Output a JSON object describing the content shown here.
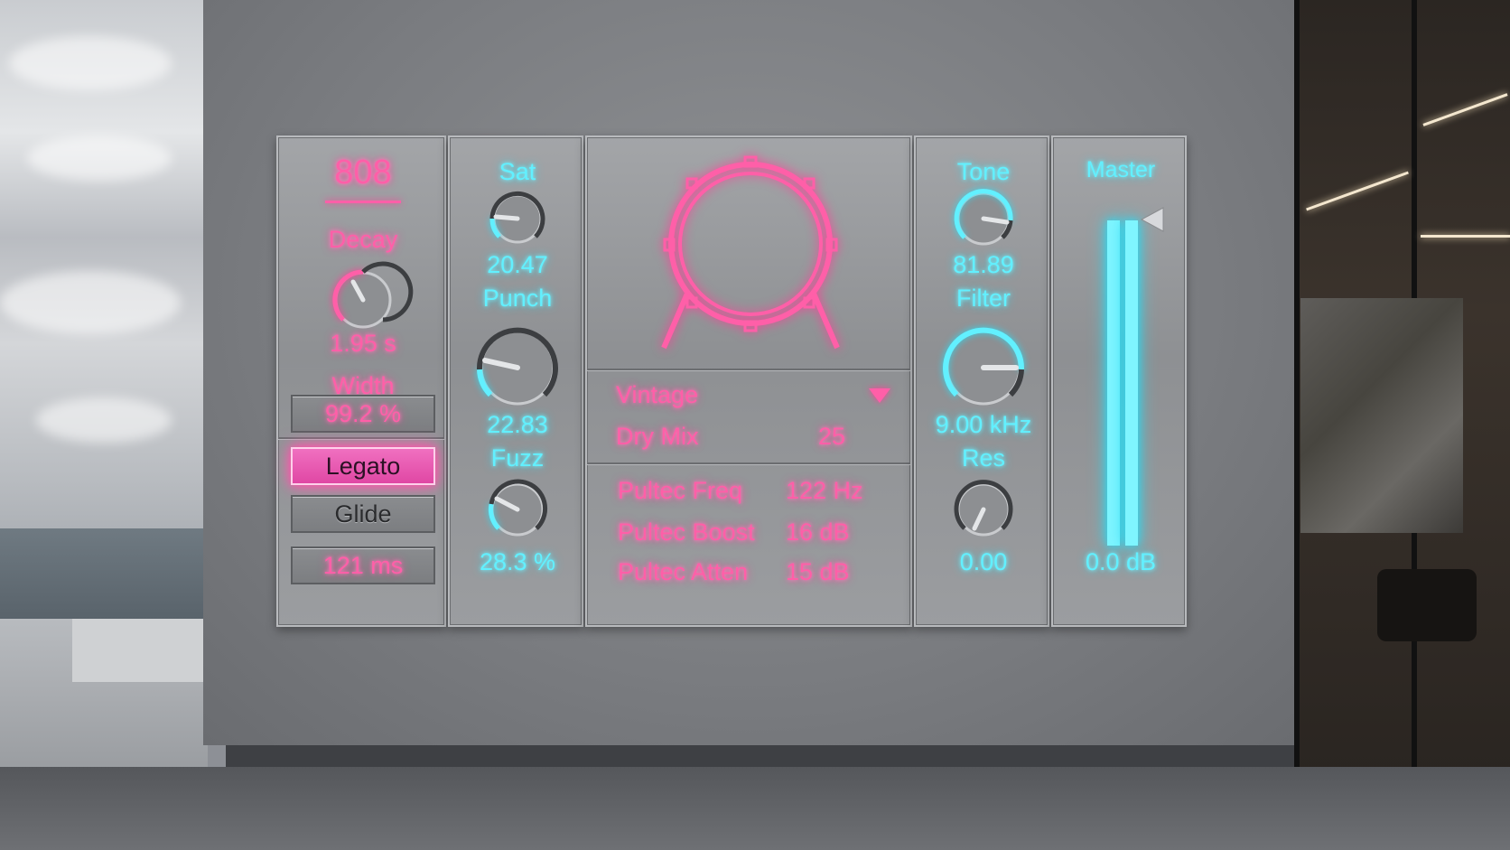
{
  "colors": {
    "pink": "#ff5fa8",
    "cyan": "#62f0ff",
    "panel": "#9a9c9f"
  },
  "voice": {
    "title": "808",
    "decay": {
      "label": "Decay",
      "value": "1.95 s"
    },
    "width": {
      "label": "Width",
      "value": "99.2 %"
    },
    "legato": {
      "label": "Legato",
      "active": true
    },
    "glide": {
      "label": "Glide",
      "active": false,
      "time": "121 ms"
    }
  },
  "drive": {
    "sat": {
      "label": "Sat",
      "value": "20.47"
    },
    "punch": {
      "label": "Punch",
      "value": "22.83"
    },
    "fuzz": {
      "label": "Fuzz",
      "value": "28.3 %"
    }
  },
  "center": {
    "drum_icon": "bass-drum-icon",
    "mode": {
      "value": "Vintage",
      "icon": "dropdown-triangle-icon"
    },
    "dry_mix": {
      "label": "Dry Mix",
      "value": "25"
    },
    "pultec": [
      {
        "label": "Pultec Freq",
        "value": "122 Hz"
      },
      {
        "label": "Pultec Boost",
        "value": "16 dB"
      },
      {
        "label": "Pultec Atten",
        "value": "15 dB"
      }
    ]
  },
  "filter_section": {
    "tone": {
      "label": "Tone",
      "value": "81.89"
    },
    "filter": {
      "label": "Filter",
      "value": "9.00 kHz"
    },
    "res": {
      "label": "Res",
      "value": "0.00"
    }
  },
  "master": {
    "label": "Master",
    "value": "0.0 dB",
    "meter_level": 1.0
  }
}
